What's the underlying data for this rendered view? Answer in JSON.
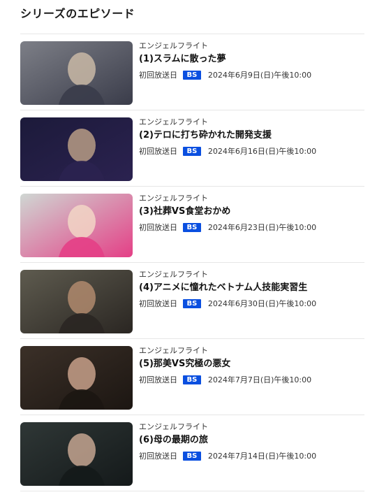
{
  "section": {
    "title": "シリーズのエピソード"
  },
  "episodes": [
    {
      "series": "エンジェルフライト",
      "title": "(1)スラムに散った夢",
      "air_label": "初回放送日",
      "channel": "BS",
      "air_date": "2024年6月9日(日)午後10:00",
      "thumb_colors": [
        "#7d7f87",
        "#3a3c4a",
        "#c9b8a6"
      ]
    },
    {
      "series": "エンジェルフライト",
      "title": "(2)テロに打ち砕かれた開発支援",
      "air_label": "初回放送日",
      "channel": "BS",
      "air_date": "2024年6月16日(日)午後10:00",
      "thumb_colors": [
        "#1c1a3a",
        "#2b2250",
        "#b79c85"
      ]
    },
    {
      "series": "エンジェルフライト",
      "title": "(3)社葬VS食堂おかめ",
      "air_label": "初回放送日",
      "channel": "BS",
      "air_date": "2024年6月23日(日)午後10:00",
      "thumb_colors": [
        "#cfd7d3",
        "#e43f86",
        "#f2d6c6"
      ]
    },
    {
      "series": "エンジェルフライト",
      "title": "(4)アニメに憧れたベトナム人技能実習生",
      "air_label": "初回放送日",
      "channel": "BS",
      "air_date": "2024年6月30日(日)午後10:00",
      "thumb_colors": [
        "#5e5b4f",
        "#2a2622",
        "#b08a6d"
      ]
    },
    {
      "series": "エンジェルフライト",
      "title": "(5)那美VS究極の悪女",
      "air_label": "初回放送日",
      "channel": "BS",
      "air_date": "2024年7月7日(日)午後10:00",
      "thumb_colors": [
        "#3b3028",
        "#1c1612",
        "#c7a08a"
      ]
    },
    {
      "series": "エンジェルフライト",
      "title": "(6)母の最期の旅",
      "air_label": "初回放送日",
      "channel": "BS",
      "air_date": "2024年7月14日(日)午後10:00",
      "thumb_colors": [
        "#2f3736",
        "#14191a",
        "#c4a590"
      ]
    }
  ]
}
